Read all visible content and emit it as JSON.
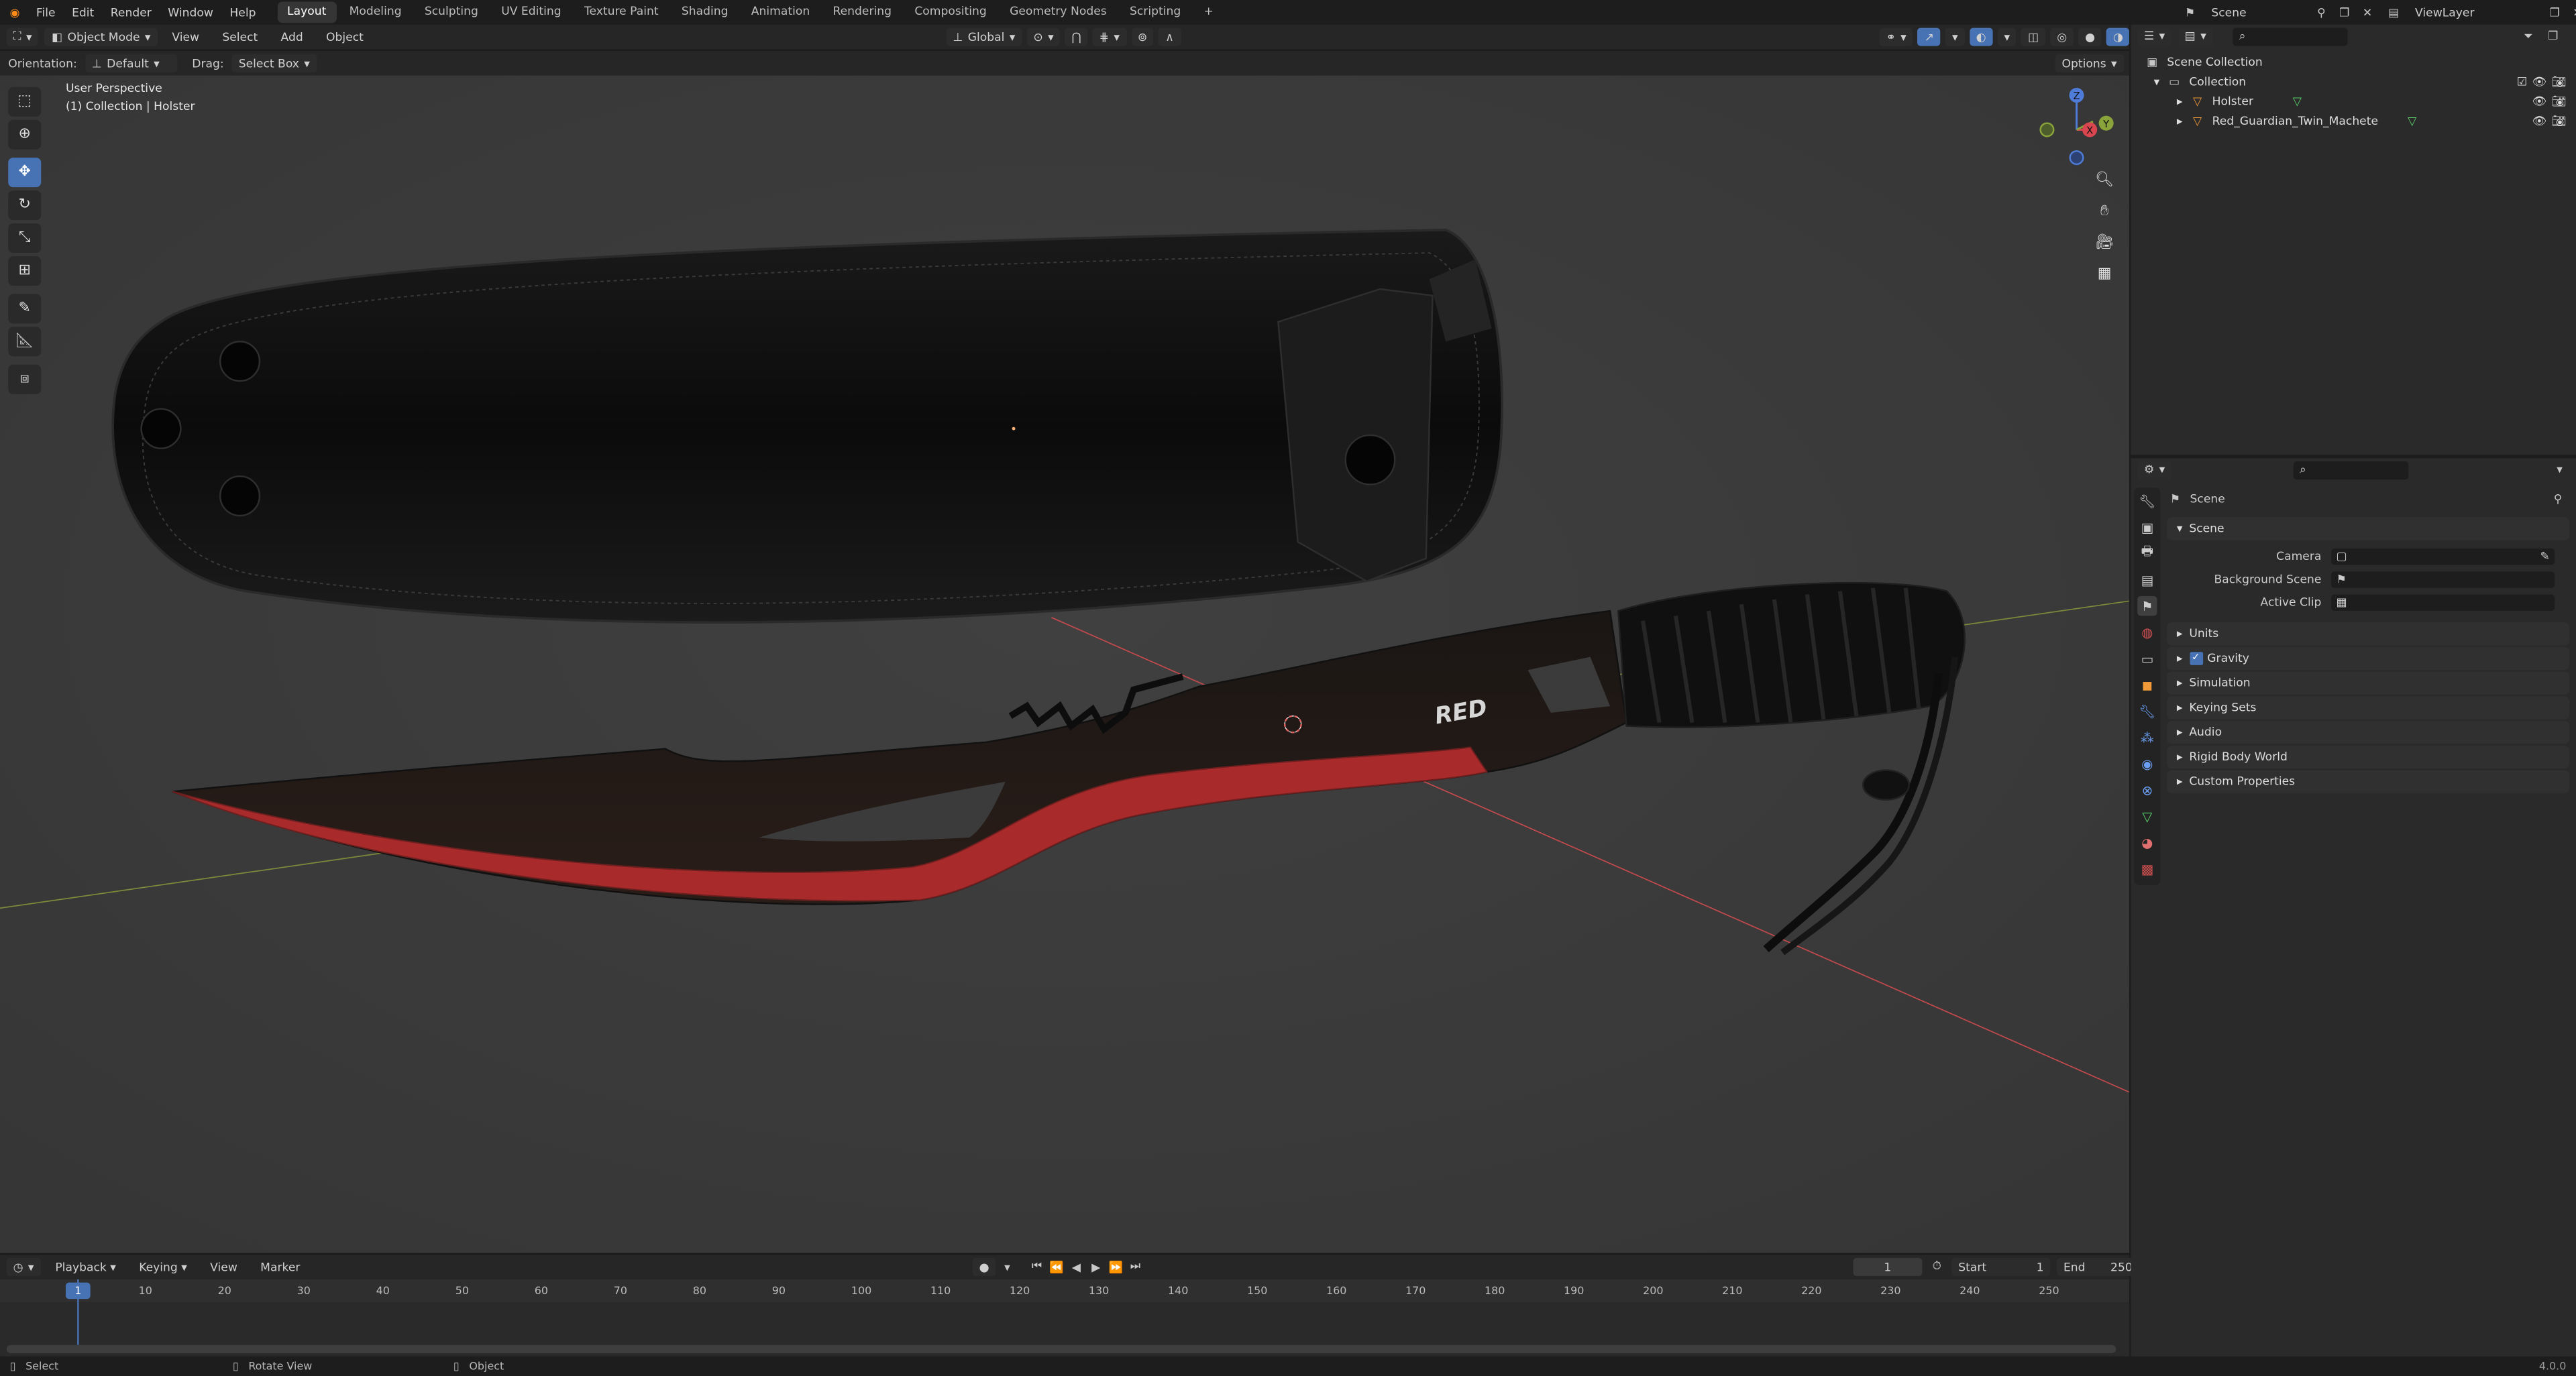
{
  "topbar": {
    "menus": [
      "File",
      "Edit",
      "Render",
      "Window",
      "Help"
    ],
    "workspaces": [
      "Layout",
      "Modeling",
      "Sculpting",
      "UV Editing",
      "Texture Paint",
      "Shading",
      "Animation",
      "Rendering",
      "Compositing",
      "Geometry Nodes",
      "Scripting"
    ],
    "active_workspace": "Layout",
    "scene": "Scene",
    "view_layer": "ViewLayer",
    "add_tab": "+"
  },
  "viewport_header": {
    "mode": "Object Mode",
    "menus": [
      "View",
      "Select",
      "Add",
      "Object"
    ],
    "transform": "Global"
  },
  "tool_header": {
    "orientation_label": "Orientation:",
    "orientation_value": "Default",
    "drag_label": "Drag:",
    "drag_value": "Select Box",
    "options": "Options"
  },
  "viewport": {
    "perspective": "User Perspective",
    "collection_info": "(1) Collection | Holster",
    "decal": "RED",
    "gizmo": {
      "x": "X",
      "y": "Y",
      "z": "Z"
    }
  },
  "timeline": {
    "menus": [
      "Playback",
      "Keying",
      "View",
      "Marker"
    ],
    "current_frame": "1",
    "start_label": "Start",
    "start": "1",
    "end_label": "End",
    "end": "250",
    "ruler": [
      "1",
      "10",
      "20",
      "30",
      "40",
      "50",
      "60",
      "70",
      "80",
      "90",
      "100",
      "110",
      "120",
      "130",
      "140",
      "150",
      "160",
      "170",
      "180",
      "190",
      "200",
      "210",
      "220",
      "230",
      "240",
      "250"
    ]
  },
  "statusbar": {
    "select": "Select",
    "rotate": "Rotate View",
    "object": "Object",
    "version": "4.0.0"
  },
  "outliner": {
    "scene_collection": "Scene Collection",
    "collection": "Collection",
    "objects": [
      "Holster",
      "Red_Guardian_Twin_Machete"
    ]
  },
  "properties": {
    "title": "Scene",
    "section": "Scene",
    "fields": [
      {
        "label": "Camera"
      },
      {
        "label": "Background Scene"
      },
      {
        "label": "Active Clip"
      }
    ],
    "panels": [
      "Units",
      "Gravity",
      "Simulation",
      "Keying Sets",
      "Audio",
      "Rigid Body World",
      "Custom Properties"
    ]
  },
  "colors": {
    "accent": "#4772b3",
    "blade_red": "#a82a2a",
    "axis_x": "#d9464f",
    "axis_y": "#8aa33a",
    "axis_z": "#4f7cd6"
  }
}
